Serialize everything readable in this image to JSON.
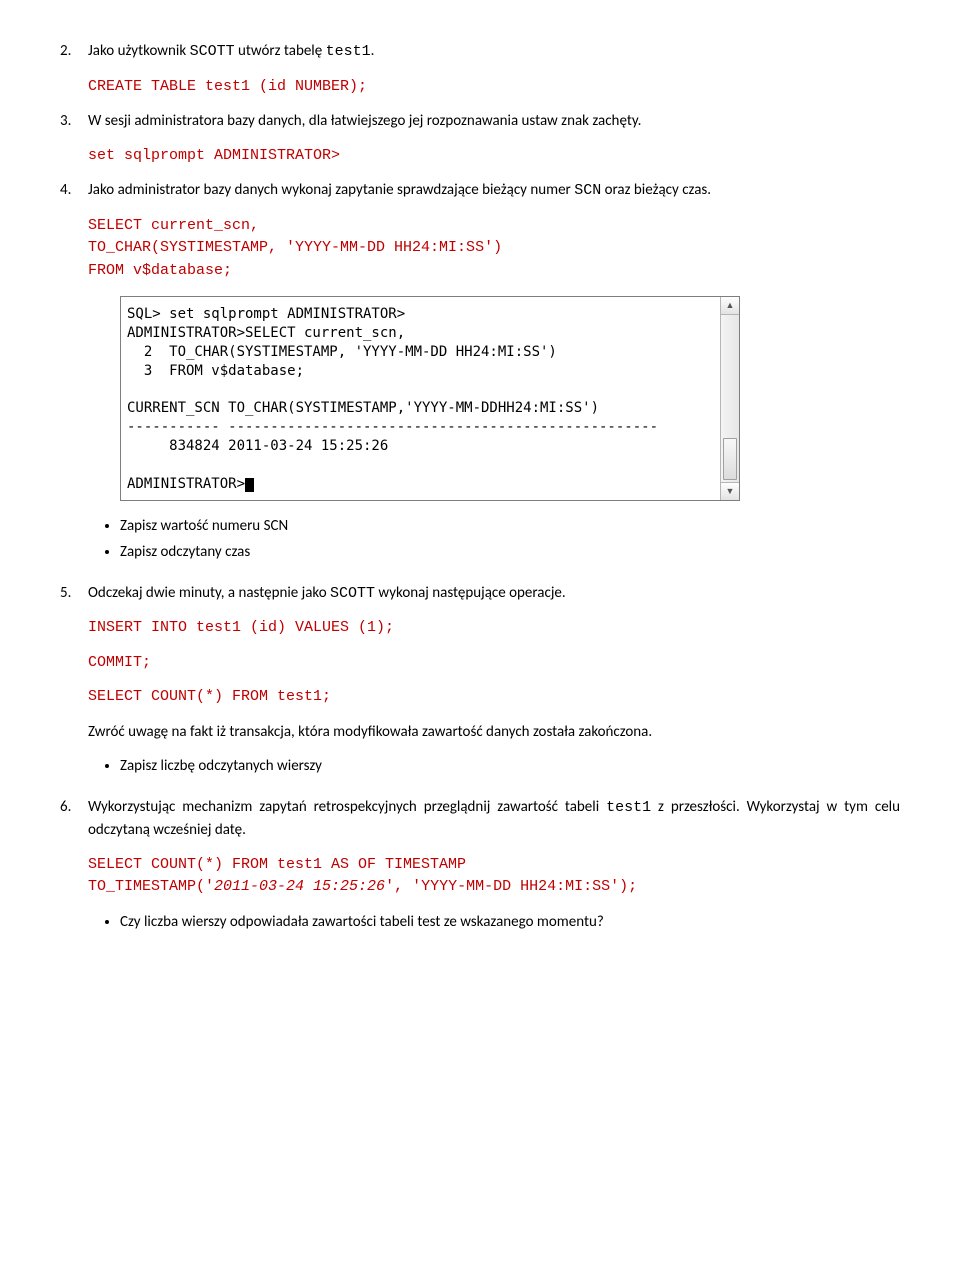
{
  "item2": {
    "num": "2.",
    "text_a": "Jako użytkownik ",
    "code_a": "SCOTT",
    "text_b": " utwórz tabelę ",
    "code_b": "test1",
    "text_c": ".",
    "code_block": "CREATE TABLE test1 (id NUMBER);"
  },
  "item3": {
    "num": "3.",
    "text": "W sesji administratora bazy danych, dla łatwiejszego jej rozpoznawania ustaw znak zachęty.",
    "code_block": "set sqlprompt ADMINISTRATOR>"
  },
  "item4": {
    "num": "4.",
    "text_a": "Jako administrator bazy danych wykonaj zapytanie sprawdzające bieżący numer ",
    "code_a": "SCN",
    "text_b": " oraz bieżący czas.",
    "code_block": "SELECT current_scn,\nTO_CHAR(SYSTIMESTAMP, 'YYYY-MM-DD HH24:MI:SS')\nFROM v$database;"
  },
  "terminal": {
    "l1": "SQL> set sqlprompt ADMINISTRATOR>",
    "l2": "ADMINISTRATOR>SELECT current_scn,",
    "l3": "  2  TO_CHAR(SYSTIMESTAMP, 'YYYY-MM-DD HH24:MI:SS')",
    "l4": "  3  FROM v$database;",
    "l5": "",
    "l6": "CURRENT_SCN TO_CHAR(SYSTIMESTAMP,'YYYY-MM-DDHH24:MI:SS')",
    "l7": "----------- ---------------------------------------------------",
    "l8": "     834824 2011-03-24 15:25:26",
    "l9": "",
    "l10": "ADMINISTRATOR>"
  },
  "bullets4": {
    "b1": "Zapisz wartość numeru SCN",
    "b2": "Zapisz odczytany czas"
  },
  "item5": {
    "num": "5.",
    "text_a": "Odczekaj dwie minuty, a następnie jako ",
    "code_a": "SCOTT",
    "text_b": " wykonaj następujące operacje.",
    "code1": "INSERT INTO test1 (id) VALUES (1);",
    "code2": "COMMIT;",
    "code3": "SELECT COUNT(*) FROM test1;",
    "text_after": "Zwróć uwagę na fakt iż transakcja, która modyfikowała zawartość danych została zakończona.",
    "bullet": "Zapisz liczbę odczytanych wierszy"
  },
  "item6": {
    "num": "6.",
    "text_a": "Wykorzystując mechanizm zapytań retrospekcyjnych przeglądnij zawartość tabeli ",
    "code_a": "test1",
    "text_b": " z przeszłości. Wykorzystaj w tym celu odczytaną wcześniej datę.",
    "code_l1": "SELECT COUNT(*) FROM test1 AS OF TIMESTAMP",
    "code_l2a": "TO_TIMESTAMP('",
    "code_l2b": "2011-03-24 15:25:26",
    "code_l2c": "', 'YYYY-MM-DD HH24:MI:SS');",
    "bullet": "Czy liczba wierszy odpowiadała zawartości tabeli test ze wskazanego momentu?"
  }
}
